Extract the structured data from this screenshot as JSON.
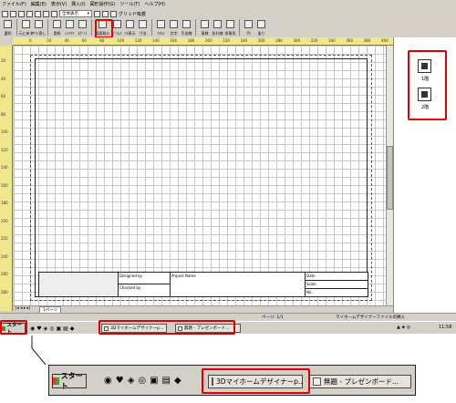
{
  "menu": [
    "ファイル(F)",
    "編集(E)",
    "表示(V)",
    "挿入(I)",
    "図形操作(G)",
    "ツール(T)",
    "ヘルプ(H)"
  ],
  "toolbar1": {
    "zoom_select": "全体表示",
    "grid_label": "グリッド吸着"
  },
  "toolbar2": [
    {
      "icon": "pointer-icon",
      "label": "選択"
    },
    {
      "icon": "undo-icon",
      "label": "元に戻す"
    },
    {
      "icon": "redo-icon",
      "label": "やり直し"
    },
    {
      "icon": "page-icon",
      "label": "用紙"
    },
    {
      "icon": "pageset-icon",
      "label": "ﾚｲｱｳﾄ"
    },
    {
      "icon": "eyedrop-icon",
      "label": "ｽﾎﾟｲﾄ"
    },
    {
      "icon": "insert-drawing-icon",
      "label": "図面取込"
    },
    {
      "icon": "table-icon",
      "label": "ﾌﾞﾛｯｸ"
    },
    {
      "icon": "frame-icon",
      "label": "ﾜｸ表示"
    },
    {
      "icon": "dimension-icon",
      "label": "寸法"
    },
    {
      "icon": "text-icon",
      "label": "ﾃｷｽﾄ"
    },
    {
      "icon": "font-icon",
      "label": "文字"
    },
    {
      "icon": "leader-icon",
      "label": "引出線"
    },
    {
      "icon": "line-icon",
      "label": "直線"
    },
    {
      "icon": "polyline-icon",
      "label": "折れ線"
    },
    {
      "icon": "polygon-icon",
      "label": "多角形"
    },
    {
      "icon": "circle-icon",
      "label": "円"
    },
    {
      "icon": "fill-icon",
      "label": "塗り"
    }
  ],
  "ruler_top": [
    "0",
    "20",
    "40",
    "60",
    "80",
    "100",
    "120",
    "140",
    "160",
    "180",
    "200",
    "220",
    "240",
    "260",
    "280",
    "300",
    "320",
    "340",
    "360",
    "380",
    "400",
    "420"
  ],
  "ruler_left": [
    "20",
    "40",
    "60",
    "80",
    "100",
    "120",
    "140",
    "160",
    "180",
    "200",
    "220",
    "240",
    "260",
    "280"
  ],
  "title_block": {
    "designed_by": "Designed by",
    "checked_by": "Checked by",
    "project_name": "Project Name",
    "date": "Date",
    "scale": "Scale",
    "no": "No."
  },
  "page_tab": "1ページ",
  "status": {
    "page": "ページ: 1/1",
    "message": "マイホームデザイナーファイルの挿入"
  },
  "panel": {
    "floor1": "1階",
    "floor2": "2階"
  },
  "taskbar": {
    "start": "スタート",
    "task1": "3Dマイホームデザイナーp...",
    "task2": "無題 - プレゼンボード...",
    "clock": "11:58"
  },
  "zoom_taskbar": {
    "start": "スタート",
    "task1": "3Dマイホームデザイナーp...",
    "task2": "無題 - プレゼンボード..."
  },
  "colors": {
    "highlight": "#e00000",
    "ruler": "#f0e68c",
    "chrome": "#d4d0c8"
  }
}
